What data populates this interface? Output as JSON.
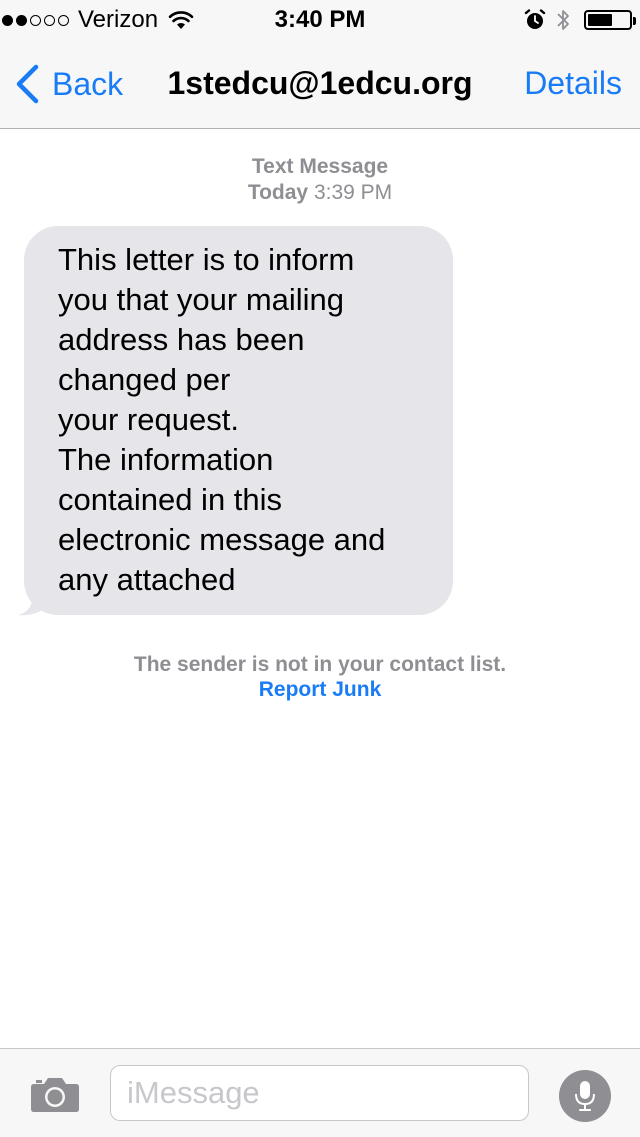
{
  "status_bar": {
    "carrier": "Verizon",
    "time": "3:40 PM",
    "signal_bars_filled": 2,
    "signal_bars_total": 5,
    "battery_level": 0.6,
    "icons": [
      "signal-icon",
      "wifi-icon",
      "alarm-icon",
      "bluetooth-icon",
      "battery-icon"
    ]
  },
  "nav": {
    "back_label": "Back",
    "title": "1stedcu@1edcu.org",
    "details_label": "Details"
  },
  "conversation": {
    "type_label": "Text Message",
    "day_label": "Today",
    "time_label": "3:39 PM",
    "message_lines": [
      "This letter is to inform",
      "you that your mailing",
      "address has been",
      "changed per",
      "your request.",
      "The information",
      "contained in this",
      "electronic message and",
      "any attached"
    ],
    "sender_notice": "The sender is not in your contact list.",
    "report_label": "Report Junk"
  },
  "input": {
    "placeholder": "iMessage",
    "value": ""
  },
  "colors": {
    "accent": "#1a7cf5",
    "bubble": "#e5e5ea",
    "bar_background": "#f7f7f7",
    "meta_text": "#8e8e93",
    "mic_button": "#8e8e93"
  }
}
